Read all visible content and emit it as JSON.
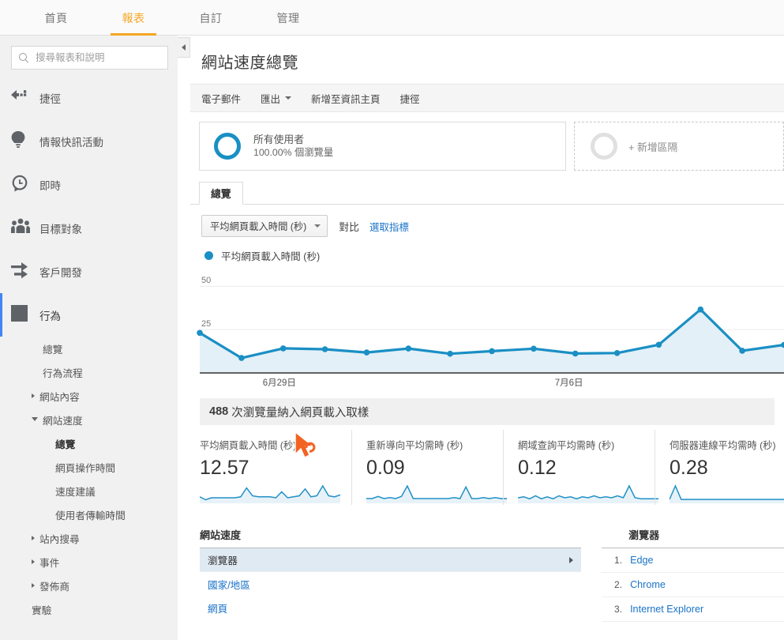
{
  "topnav": {
    "tabs": [
      {
        "label": "首頁",
        "active": false
      },
      {
        "label": "報表",
        "active": true
      },
      {
        "label": "自訂",
        "active": false
      },
      {
        "label": "管理",
        "active": false
      }
    ]
  },
  "sidebar": {
    "search": {
      "placeholder": "搜尋報表和說明",
      "value": "",
      "icon": "search-icon"
    },
    "items": [
      {
        "label": "捷徑",
        "icon": "shortcut-arrow-icon"
      },
      {
        "label": "情報快訊活動",
        "icon": "lightbulb-icon"
      },
      {
        "label": "即時",
        "icon": "clock-icon"
      },
      {
        "label": "目標對象",
        "icon": "people-icon"
      },
      {
        "label": "客戶開發",
        "icon": "acquisition-arrows-icon"
      },
      {
        "label": "行為",
        "icon": "behavior-layout-icon",
        "selected": true
      }
    ],
    "behavior_children": [
      {
        "label": "總覽",
        "type": "leaf"
      },
      {
        "label": "行為流程",
        "type": "leaf"
      },
      {
        "label": "網站內容",
        "type": "group",
        "expanded": false
      },
      {
        "label": "網站速度",
        "type": "group",
        "expanded": true
      }
    ],
    "site_speed_children": [
      {
        "label": "總覽",
        "current": true
      },
      {
        "label": "網頁操作時間",
        "current": false
      },
      {
        "label": "速度建議",
        "current": false
      },
      {
        "label": "使用者傳輸時間",
        "current": false
      }
    ],
    "behavior_children_after": [
      {
        "label": "站內搜尋",
        "type": "group",
        "expanded": false
      },
      {
        "label": "事件",
        "type": "group",
        "expanded": false
      },
      {
        "label": "發佈商",
        "type": "group",
        "expanded": false
      }
    ],
    "footer_items": [
      {
        "label": "實驗",
        "type": "leaf"
      }
    ],
    "collapse_icon": "chevron-left-icon"
  },
  "main": {
    "title": "網站速度總覽",
    "actions": [
      {
        "label": "電子郵件",
        "dropdown": false
      },
      {
        "label": "匯出",
        "dropdown": true
      },
      {
        "label": "新增至資訊主頁",
        "dropdown": false
      },
      {
        "label": "捷徑",
        "dropdown": false
      }
    ],
    "segments": {
      "primary": {
        "title": "所有使用者",
        "subtitle": "100.00% 個瀏覽量",
        "donut_color": "#1a8fc4"
      },
      "add": {
        "label": "+ 新增區隔"
      }
    },
    "tabs": [
      {
        "label": "總覽",
        "active": true
      }
    ],
    "metric_selector": {
      "selected": "平均網頁載入時間 (秒)",
      "compare_label": "對比",
      "select_metric_link": "選取指標"
    },
    "legend": [
      {
        "label": "平均網頁載入時間 (秒)",
        "color": "#1a8fc4"
      }
    ],
    "sample_notice": {
      "count": "488",
      "text": "次瀏覽量納入網頁載入取樣"
    },
    "metric_cards": [
      {
        "title": "平均網頁載入時間 (秒)",
        "value": "12.57"
      },
      {
        "title": "重新導向平均需時 (秒)",
        "value": "0.09"
      },
      {
        "title": "網域查詢平均需時 (秒)",
        "value": "0.12"
      },
      {
        "title": "伺服器連線平均需時 (秒)",
        "value": "0.28"
      }
    ],
    "site_speed_panel": {
      "title": "網站速度",
      "rows": [
        {
          "label": "瀏覽器",
          "selected": true
        },
        {
          "label": "國家/地區",
          "selected": false
        },
        {
          "label": "網頁",
          "selected": false
        }
      ]
    },
    "browser_panel": {
      "title": "瀏覽器",
      "rows": [
        {
          "rank": "1.",
          "name": "Edge"
        },
        {
          "rank": "2.",
          "name": "Chrome"
        },
        {
          "rank": "3.",
          "name": "Internet Explorer"
        }
      ]
    }
  },
  "chart_data": {
    "type": "line",
    "title": "平均網頁載入時間 (秒)",
    "xlabel": "",
    "ylabel": "",
    "ylim": [
      0,
      57
    ],
    "yticks": [
      25,
      50
    ],
    "ytick_labels": [
      "25",
      "50"
    ],
    "grid": true,
    "legend_position": "top-left",
    "x_tick_labels": [
      "6月29日",
      "7月6日"
    ],
    "x_tick_positions": [
      2,
      9
    ],
    "series": [
      {
        "name": "平均網頁載入時間 (秒)",
        "color": "#1a8fc4",
        "fill": "#e3f0f7",
        "values": [
          23.1,
          8.6,
          14.2,
          13.7,
          11.8,
          14.1,
          11.1,
          12.6,
          14.0,
          11.2,
          11.5,
          16.3,
          36.6,
          12.8,
          16.2
        ]
      }
    ],
    "sparklines": [
      {
        "name": "平均網頁載入時間 (秒)",
        "values": [
          5,
          2,
          4,
          4,
          4,
          4,
          4,
          5,
          14,
          6,
          5,
          5,
          5,
          4,
          10,
          4,
          5,
          6,
          13,
          5,
          6,
          16,
          6,
          5,
          7
        ]
      },
      {
        "name": "重新導向平均需時 (秒)",
        "values": [
          3,
          3,
          5,
          3,
          4,
          3,
          5,
          15,
          3,
          3,
          3,
          3,
          3,
          3,
          3,
          4,
          3,
          14,
          3,
          3,
          4,
          3,
          4,
          3,
          3
        ]
      },
      {
        "name": "網域查詢平均需時 (秒)",
        "values": [
          4,
          5,
          3,
          6,
          3,
          5,
          3,
          6,
          4,
          5,
          3,
          5,
          4,
          6,
          4,
          5,
          4,
          6,
          4,
          16,
          4,
          3,
          3,
          3,
          3
        ]
      },
      {
        "name": "伺服器連線平均需時 (秒)",
        "values": [
          2,
          14,
          2,
          2,
          2,
          2,
          2,
          2,
          2,
          2,
          2,
          2,
          2,
          2,
          2,
          2,
          2,
          2,
          2,
          2,
          2,
          2,
          2,
          2,
          2
        ]
      }
    ]
  }
}
